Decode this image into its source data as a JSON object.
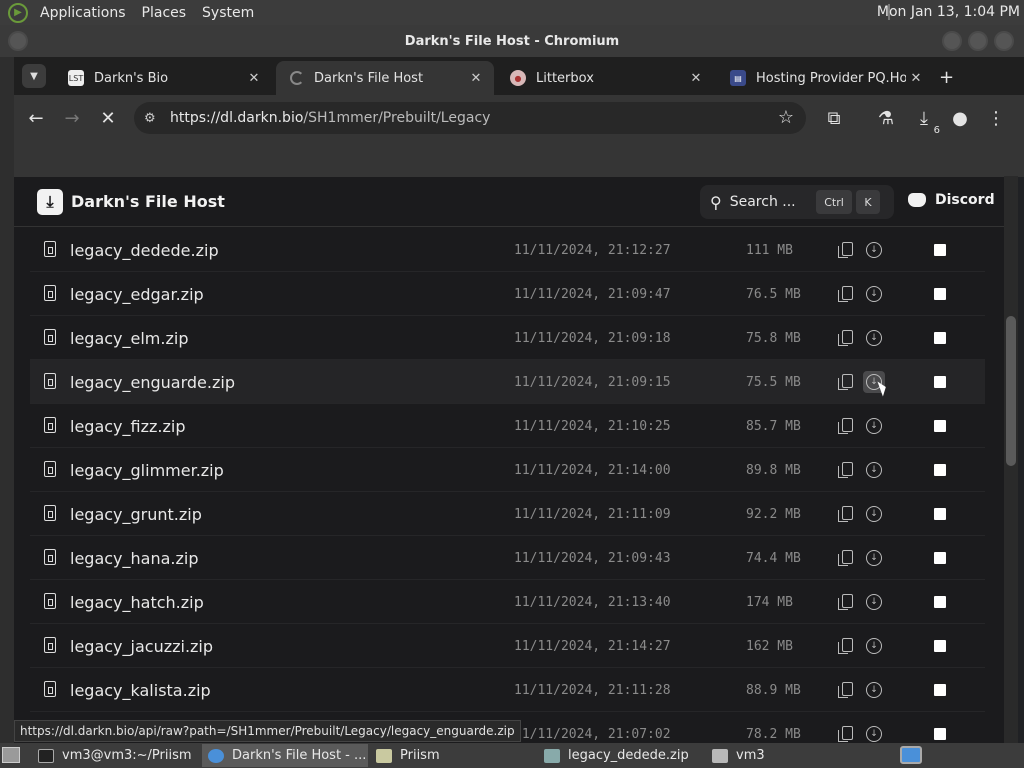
{
  "os_panel": {
    "menus": [
      "Applications",
      "Places",
      "System"
    ],
    "clock": "Mon Jan 13, 1:04 PM"
  },
  "window": {
    "title": "Darkn's File Host - Chromium"
  },
  "tabs": [
    {
      "title": "Darkn's Bio",
      "favicon": "bio-favicon",
      "active": false
    },
    {
      "title": "Darkn's File Host",
      "favicon": "loading-spinner",
      "active": true
    },
    {
      "title": "Litterbox",
      "favicon": "litterbox-favicon",
      "active": false
    },
    {
      "title": "Hosting Provider PQ.Host",
      "favicon": "pqhost-favicon",
      "active": false
    }
  ],
  "toolbar": {
    "url_host": "https://dl.darkn.bio",
    "url_path": "/SH1mmer/Prebuilt/Legacy",
    "downloads_badge": "6"
  },
  "site": {
    "brand": "Darkn's File Host",
    "search_label": "Search ...",
    "kbd_ctrl": "Ctrl",
    "kbd_k": "K",
    "discord_label": "Discord"
  },
  "files": [
    {
      "name": "legacy_dedede.zip",
      "date": "11/11/2024, 21:12:27",
      "size": "111 MB"
    },
    {
      "name": "legacy_edgar.zip",
      "date": "11/11/2024, 21:09:47",
      "size": "76.5 MB"
    },
    {
      "name": "legacy_elm.zip",
      "date": "11/11/2024, 21:09:18",
      "size": "75.8 MB"
    },
    {
      "name": "legacy_enguarde.zip",
      "date": "11/11/2024, 21:09:15",
      "size": "75.5 MB"
    },
    {
      "name": "legacy_fizz.zip",
      "date": "11/11/2024, 21:10:25",
      "size": "85.7 MB"
    },
    {
      "name": "legacy_glimmer.zip",
      "date": "11/11/2024, 21:14:00",
      "size": "89.8 MB"
    },
    {
      "name": "legacy_grunt.zip",
      "date": "11/11/2024, 21:11:09",
      "size": "92.2 MB"
    },
    {
      "name": "legacy_hana.zip",
      "date": "11/11/2024, 21:09:43",
      "size": "74.4 MB"
    },
    {
      "name": "legacy_hatch.zip",
      "date": "11/11/2024, 21:13:40",
      "size": "174 MB"
    },
    {
      "name": "legacy_jacuzzi.zip",
      "date": "11/11/2024, 21:14:27",
      "size": "162 MB"
    },
    {
      "name": "legacy_kalista.zip",
      "date": "11/11/2024, 21:11:28",
      "size": "88.9 MB"
    },
    {
      "name": "",
      "date": "11/11/2024, 21:07:02",
      "size": "78.2 MB"
    }
  ],
  "status_url": "https://dl.darkn.bio/api/raw?path=/SH1mmer/Prebuilt/Legacy/legacy_enguarde.zip",
  "taskbar": [
    {
      "label": "vm3@vm3:~/Priism",
      "active": false
    },
    {
      "label": "Darkn's File Host - ...",
      "active": true
    },
    {
      "label": "Priism",
      "active": false
    },
    {
      "label": "legacy_dedede.zip",
      "active": false
    },
    {
      "label": "vm3",
      "active": false
    }
  ]
}
